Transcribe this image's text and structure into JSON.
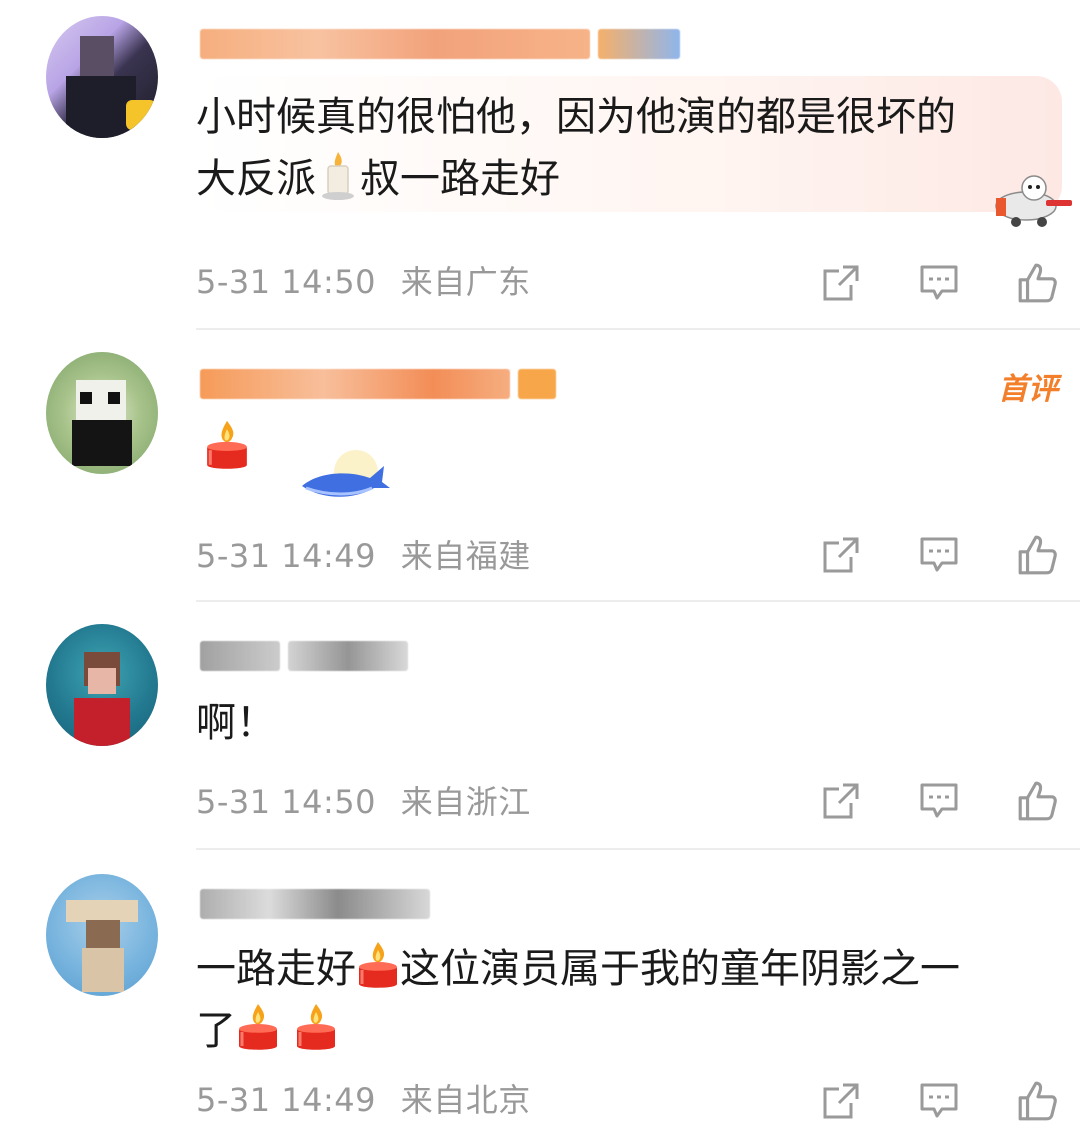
{
  "comments": [
    {
      "text": "小时候真的很怕他，因为他演的都是很坏的大反派🕯叔一路走好",
      "text_line1": "小时候真的很怕他，因为他演的都是很坏的",
      "text_line2a": "大反派",
      "text_line2b": "叔一路走好",
      "time": "5-31 14:50",
      "location": "来自广东"
    },
    {
      "badge": "首评",
      "time": "5-31 14:49",
      "location": "来自福建"
    },
    {
      "text": "啊！",
      "time": "5-31 14:50",
      "location": "来自浙江"
    },
    {
      "text_line1a": "一路走好",
      "text_line1b": "这位演员属于我的童年阴影之一",
      "text_line2": "了",
      "time": "5-31 14:49",
      "location": "来自北京"
    }
  ],
  "icons": [
    "share-icon",
    "comment-icon",
    "like-icon"
  ],
  "colors": {
    "meta_gray": "#999999",
    "divider": "#ededed",
    "badge_orange": "#f47f2a",
    "username_orange": "#f58a3c"
  }
}
